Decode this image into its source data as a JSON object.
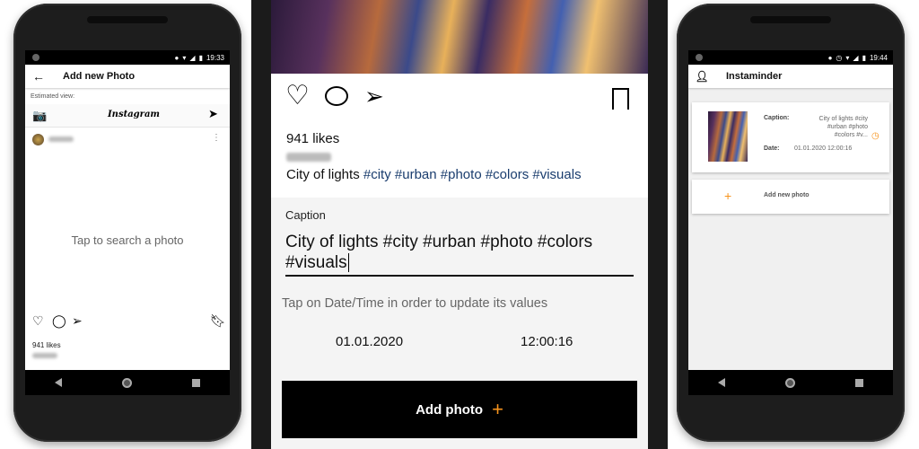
{
  "left": {
    "status_time": "19:33",
    "title": "Add new Photo",
    "estimated_view": "Estimated view:",
    "instagram_logo": "Instagram",
    "tap_to_search": "Tap to search a photo",
    "likes": "941 likes"
  },
  "center": {
    "likes": "941 likes",
    "caption_text": "City of lights",
    "hashtags": [
      "#city",
      "#urban",
      "#photo",
      "#colors",
      "#visuals"
    ],
    "caption_label": "Caption",
    "caption_input_line1": "City of lights #city #urban #photo #colors",
    "caption_input_line2": "#visuals",
    "hint": "Tap on Date/Time in order to update its values",
    "date": "01.01.2020",
    "time": "12:00:16",
    "add_photo": "Add photo",
    "add_photo_plus": "+"
  },
  "right": {
    "status_time": "19:44",
    "title": "Instaminder",
    "caption_label": "Caption:",
    "caption_value_lines": [
      "City of lights #city",
      "#urban #photo",
      "#colors #v..."
    ],
    "date_label": "Date:",
    "date_value": "01.01.2020 12:00:16",
    "add_new_photo": "Add new photo",
    "add_plus": "+"
  },
  "colors": {
    "accent": "#f7941d",
    "hashtag": "#1a3d6e",
    "button_bg": "#000000"
  },
  "icons": [
    "back-arrow-icon",
    "camera-icon",
    "send-icon",
    "more-vert-icon",
    "heart-icon",
    "comment-icon",
    "bookmark-icon",
    "person-icon",
    "clock-icon",
    "plus-icon",
    "wifi-icon",
    "signal-icon",
    "battery-icon",
    "location-icon",
    "alarm-icon"
  ]
}
